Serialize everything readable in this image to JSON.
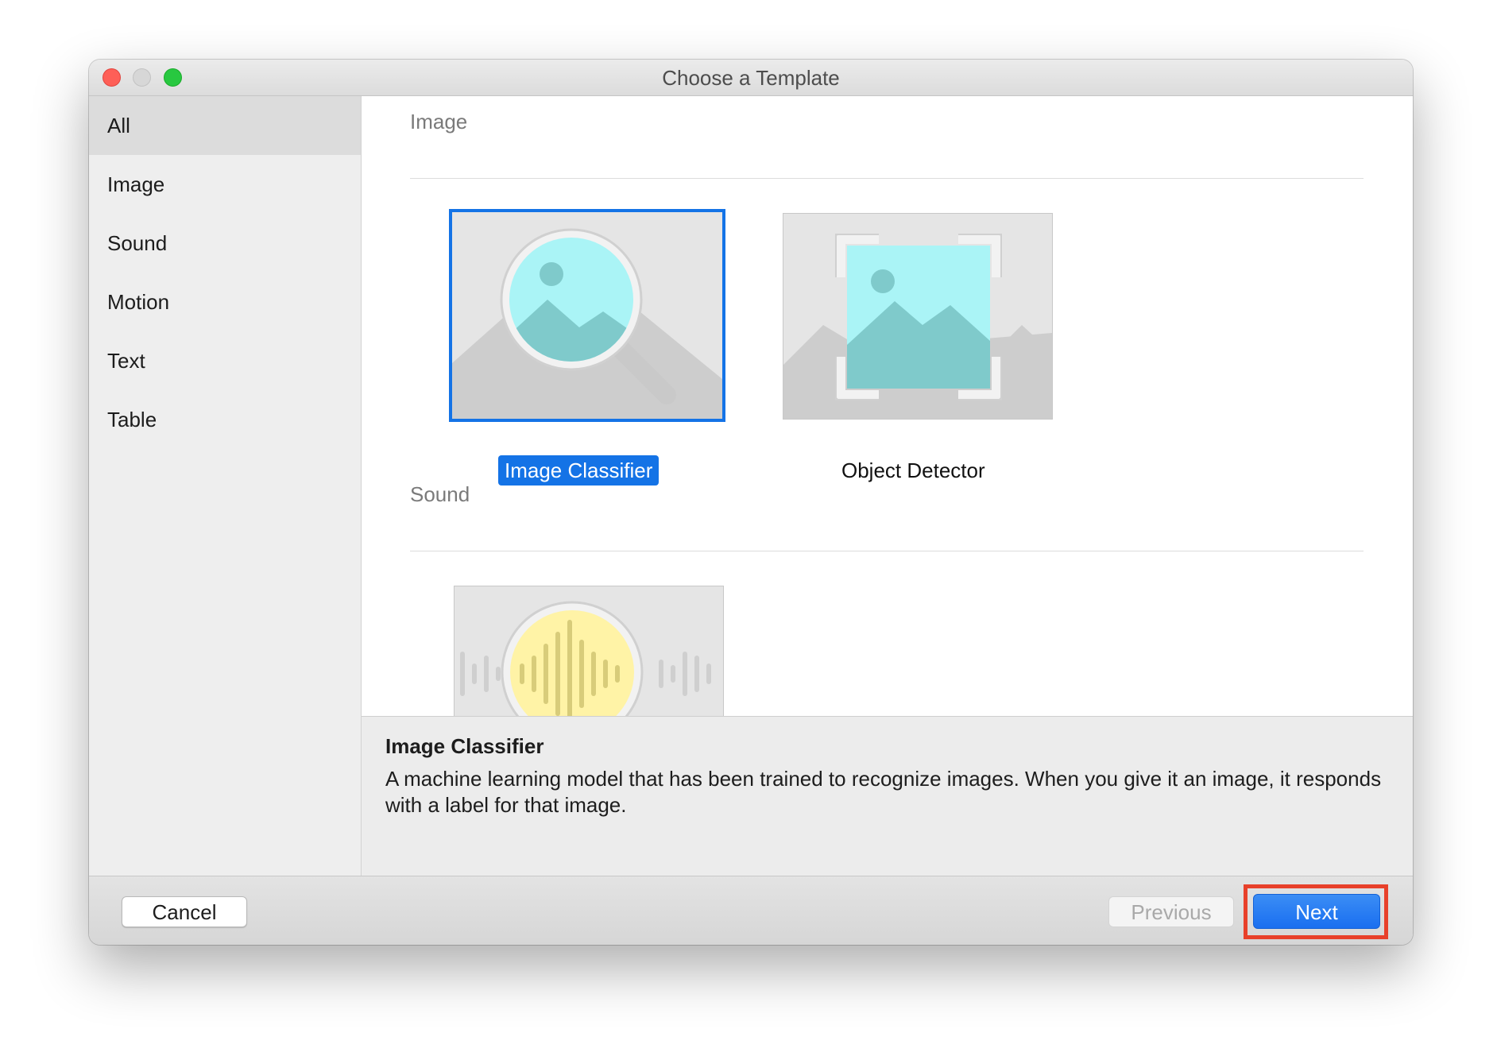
{
  "window": {
    "title": "Choose a Template"
  },
  "sidebar": {
    "items": [
      {
        "label": "All",
        "selected": true
      },
      {
        "label": "Image",
        "selected": false
      },
      {
        "label": "Sound",
        "selected": false
      },
      {
        "label": "Motion",
        "selected": false
      },
      {
        "label": "Text",
        "selected": false
      },
      {
        "label": "Table",
        "selected": false
      }
    ]
  },
  "sections": [
    {
      "title": "Image",
      "templates": [
        {
          "label": "Image Classifier",
          "icon": "image-classifier-icon",
          "selected": true
        },
        {
          "label": "Object Detector",
          "icon": "object-detector-icon",
          "selected": false
        }
      ]
    },
    {
      "title": "Sound",
      "templates": [
        {
          "label": "",
          "icon": "sound-classifier-icon",
          "selected": false
        }
      ]
    }
  ],
  "description": {
    "title": "Image Classifier",
    "body": "A machine learning model that has been trained to recognize images. When you give it an image, it responds with a label for that image."
  },
  "footer": {
    "cancel_label": "Cancel",
    "previous_label": "Previous",
    "next_label": "Next"
  },
  "colors": {
    "accent": "#1473e6",
    "highlight_box": "#e8402a",
    "image_teal": "#a9f2f2",
    "sound_yellow": "#fff3a6"
  }
}
